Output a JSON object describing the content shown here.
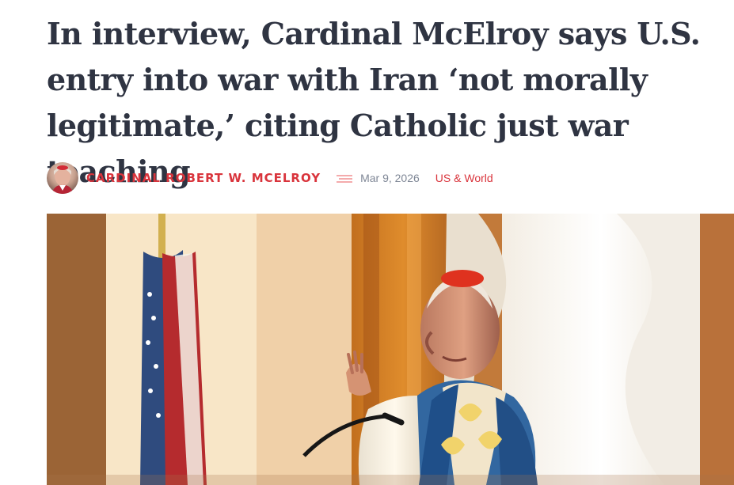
{
  "article": {
    "headline": "In interview, Cardinal McElroy says U.S. entry into war with Iran ‘not morally legitimate,’ citing Catholic just war teaching",
    "author": "CARDINAL ROBERT W. MCELROY",
    "date": "Mar 9, 2026",
    "category": "US & World"
  },
  "icons": {
    "author_avatar": "avatar",
    "separator": "menu-lines-icon"
  },
  "colors": {
    "headline": "#2f3442",
    "accent": "#d9343c",
    "meta": "#7f8796"
  }
}
